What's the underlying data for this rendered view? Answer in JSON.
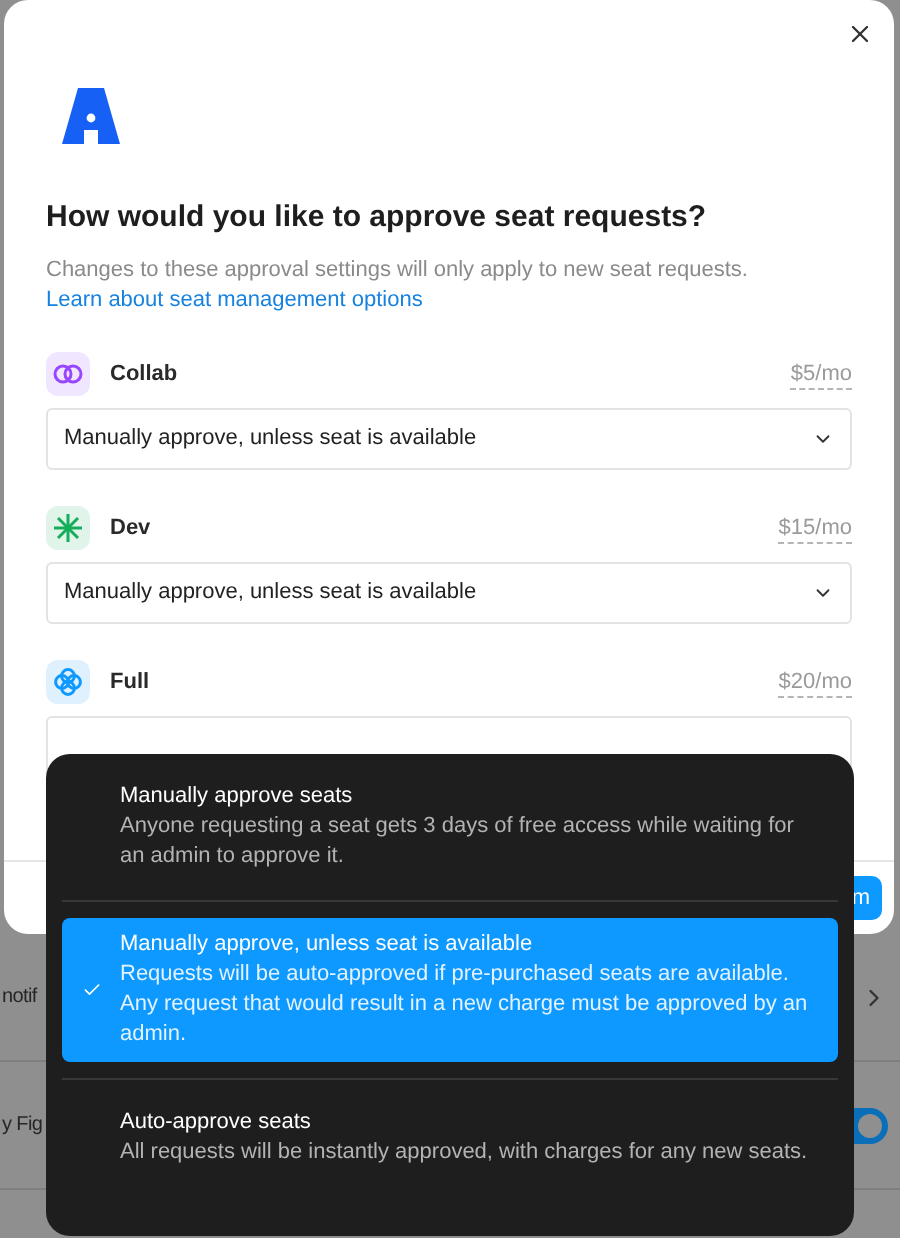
{
  "background": {
    "rows": [
      {
        "kind": "link",
        "label": "notif"
      },
      {
        "kind": "toggle",
        "label": "y Fig",
        "on": true
      }
    ]
  },
  "dialog": {
    "title": "How would you like to approve seat requests?",
    "description": "Changes to these approval settings will only apply to new seat requests.",
    "link": "Learn about seat management options",
    "seats": [
      {
        "name": "Collab",
        "kind": "rings",
        "color": "#9747ff",
        "price": "$5/mo",
        "approval": "Manually approve, unless seat is available"
      },
      {
        "name": "Dev",
        "kind": "asterisk",
        "color": "#14ae5c",
        "price": "$15/mo",
        "approval": "Manually approve, unless seat is available"
      },
      {
        "name": "Full",
        "kind": "clover",
        "color": "#0d99ff",
        "price": "$20/mo"
      }
    ],
    "confirm_button": "m"
  },
  "menu": {
    "options": [
      {
        "title": "Manually approve seats",
        "description": "Anyone requesting a seat gets 3 days of free access while waiting for an admin to approve it.",
        "selected": false
      },
      {
        "title": "Manually approve, unless seat is available",
        "description": "Requests will be auto-approved if pre-purchased seats are available. Any request that would result in a new charge must be approved by an admin.",
        "selected": true
      },
      {
        "title": "Auto-approve seats",
        "description": "All requests will be instantly approved, with charges for any new seats.",
        "selected": false
      }
    ]
  }
}
